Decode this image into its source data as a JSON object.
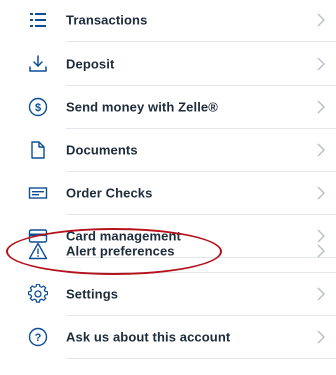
{
  "accent_color": "#0a4f96",
  "highlight_color": "#b5121b",
  "menu": {
    "items": [
      {
        "label": "Transactions",
        "icon": "list-icon"
      },
      {
        "label": "Deposit",
        "icon": "download-tray-icon"
      },
      {
        "label": "Send money with Zelle®",
        "icon": "dollar-circle-icon"
      },
      {
        "label": "Documents",
        "icon": "document-icon"
      },
      {
        "label": "Order Checks",
        "icon": "check-icon"
      },
      {
        "label": "Card management",
        "icon": "credit-card-icon"
      },
      {
        "label": "Alert preferences",
        "icon": "warning-triangle-icon",
        "highlighted": true
      },
      {
        "label": "Settings",
        "icon": "gear-icon"
      },
      {
        "label": "Ask us about this account",
        "icon": "question-circle-icon"
      }
    ]
  }
}
